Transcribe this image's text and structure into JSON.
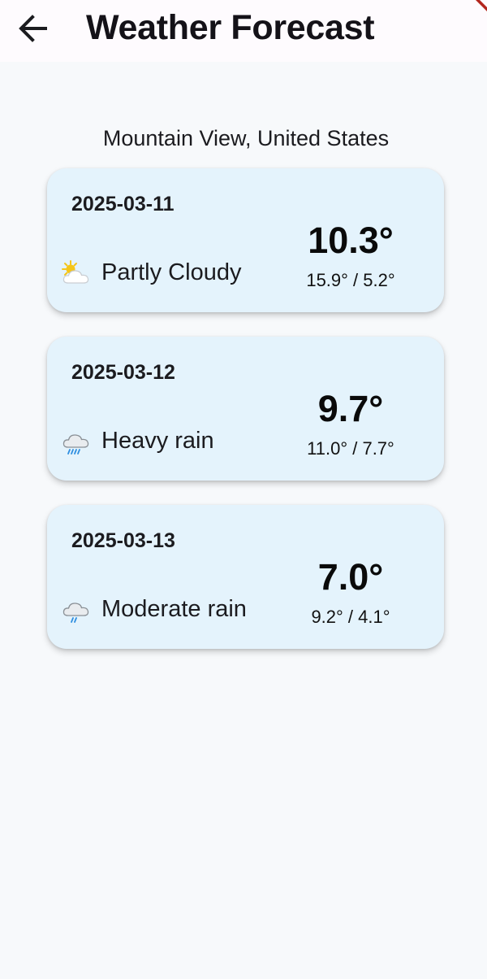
{
  "app_bar": {
    "title": "Weather Forecast",
    "back_icon": "arrow-left-icon"
  },
  "location": "Mountain View, United States",
  "forecast": [
    {
      "date": "2025-03-11",
      "condition": "Partly Cloudy",
      "icon": "partly-cloudy-icon",
      "temp": "10.3°",
      "range": "15.9° / 5.2°"
    },
    {
      "date": "2025-03-12",
      "condition": "Heavy rain",
      "icon": "heavy-rain-icon",
      "temp": "9.7°",
      "range": "11.0° / 7.7°"
    },
    {
      "date": "2025-03-13",
      "condition": "Moderate rain",
      "icon": "moderate-rain-icon",
      "temp": "7.0°",
      "range": "9.2° / 4.1°"
    }
  ],
  "colors": {
    "app_bar_bg": "#fefbfe",
    "page_bg": "#f7f9fb",
    "card_bg": "#e4f3fc",
    "rain_drop": "#2f8fe0",
    "sun": "#f5c518",
    "debug_ribbon": "#b3261e"
  }
}
